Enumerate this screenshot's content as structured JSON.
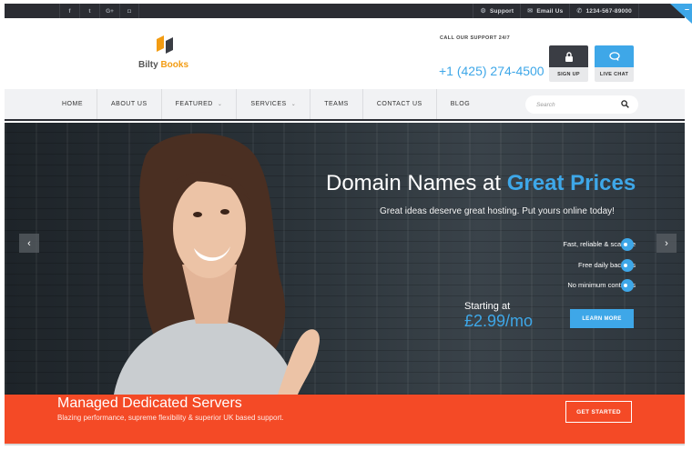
{
  "topbar": {
    "social": [
      {
        "glyph": "f",
        "icon": "facebook-icon"
      },
      {
        "glyph": "t",
        "icon": "twitter-icon"
      },
      {
        "glyph": "G+",
        "icon": "google-plus-icon"
      },
      {
        "glyph": "◘",
        "icon": "instagram-icon"
      }
    ],
    "support_label": "Support",
    "email_label": "Email Us",
    "phone": "1234-567-89000",
    "corner_glyph": "–"
  },
  "header": {
    "logo_text": "Bilty",
    "logo_text_accent": "Books",
    "support_caption": "CALL OUR SUPPORT 24/7",
    "phone_big": "+1 (425) 274-4500",
    "signup_label": "SIGN UP",
    "livechat_label": "LIVE CHAT"
  },
  "nav": {
    "items": [
      {
        "label": "HOME",
        "dropdown": false
      },
      {
        "label": "ABOUT US",
        "dropdown": false
      },
      {
        "label": "FEATURED",
        "dropdown": true
      },
      {
        "label": "SERVICES",
        "dropdown": true
      },
      {
        "label": "TEAMS",
        "dropdown": false
      },
      {
        "label": "CONTACT US",
        "dropdown": false
      },
      {
        "label": "BLOG",
        "dropdown": false
      }
    ],
    "search_placeholder": "Search"
  },
  "hero": {
    "title_main": "Domain Names at ",
    "title_accent": "Great Prices",
    "subtitle": "Great ideas deserve great hosting. Put yours online today!",
    "features": [
      "Fast, reliable & scalable",
      "Free daily backups",
      "No minimum contracts"
    ],
    "starting_label": "Starting at",
    "price": "£2.99/mo",
    "cta": "LEARN MORE",
    "prev": "‹",
    "next": "›"
  },
  "banner": {
    "title": "Managed Dedicated Servers",
    "subtitle": "Blazing performance, supreme flexibility & superior UK based support.",
    "cta": "GET STARTED"
  },
  "colors": {
    "accent": "#3ea7e8",
    "banner": "#f44a26",
    "logo": "#f39c12",
    "topbar": "#2b2d33"
  }
}
